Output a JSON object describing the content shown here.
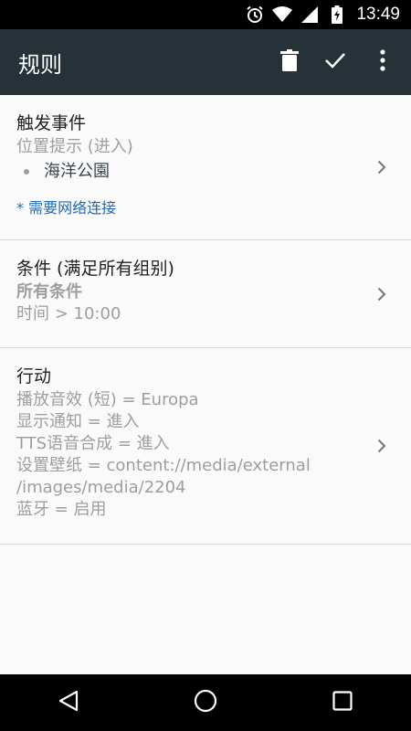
{
  "status_bar": {
    "time": "13:49",
    "icons": [
      "alarm-icon",
      "wifi-icon",
      "cell-signal-icon",
      "battery-charging-icon"
    ]
  },
  "toolbar": {
    "title": "规则",
    "actions": [
      "delete-icon",
      "check-icon",
      "more-vert-icon"
    ]
  },
  "sections": {
    "trigger": {
      "heading": "触发事件",
      "subtitle": "位置提示 (进入)",
      "location": "海洋公園",
      "note": "* 需要网络连接"
    },
    "conditions": {
      "heading": "条件 (满足所有组别)",
      "group": "所有条件",
      "items": [
        "时间 > 10:00"
      ]
    },
    "actions": {
      "heading": "行动",
      "items": [
        "播放音效 (短) = Europa",
        "显示通知 = 進入",
        "TTS语音合成 = 進入",
        "设置壁纸 = content://media/external",
        "/images/media/2204",
        "蓝牙 = 启用"
      ]
    }
  },
  "navigation": [
    "back-icon",
    "home-icon",
    "recents-icon"
  ],
  "colors": {
    "toolbar_bg": "#263238",
    "link": "#1e6bb8",
    "secondary_text": "#9e9e9e"
  }
}
